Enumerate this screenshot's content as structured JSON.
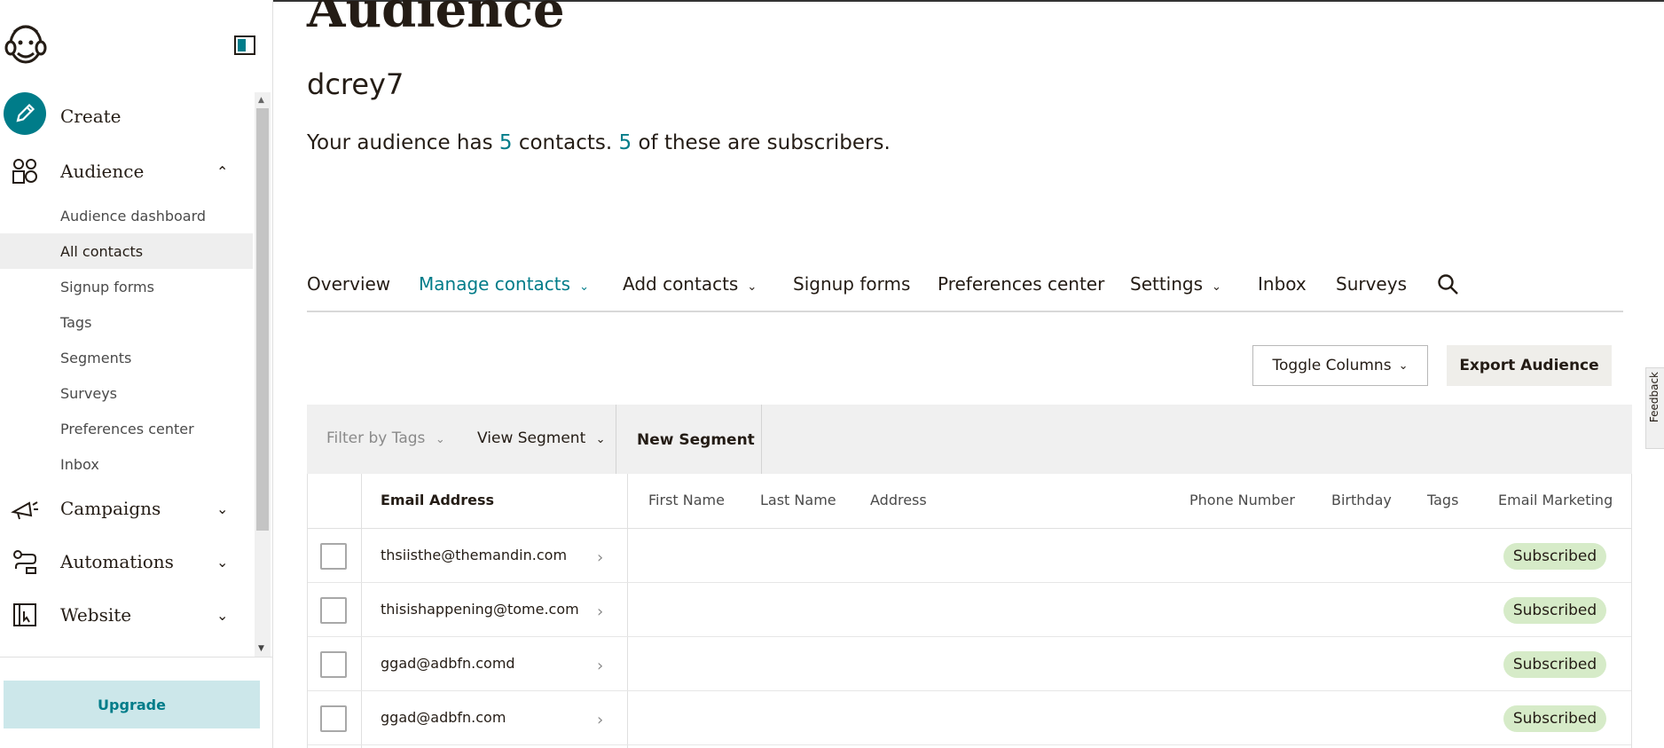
{
  "sidebar": {
    "nav": {
      "create": "Create",
      "audience": "Audience",
      "campaigns": "Campaigns",
      "automations": "Automations",
      "website": "Website"
    },
    "audience_sub": [
      "Audience dashboard",
      "All contacts",
      "Signup forms",
      "Tags",
      "Segments",
      "Surveys",
      "Preferences center",
      "Inbox"
    ],
    "active_sub": "All contacts",
    "upgrade": "Upgrade"
  },
  "page": {
    "title": "Audience",
    "audience_name": "dcrey7",
    "summary": {
      "prefix": "Your audience has ",
      "contacts": "5",
      "middle": " contacts. ",
      "subscribers": "5",
      "suffix": " of these are subscribers."
    }
  },
  "tabs": [
    {
      "label": "Overview"
    },
    {
      "label": "Manage contacts"
    },
    {
      "label": "Add contacts"
    },
    {
      "label": "Signup forms"
    },
    {
      "label": "Preferences center"
    },
    {
      "label": "Settings"
    },
    {
      "label": "Inbox"
    },
    {
      "label": "Surveys"
    }
  ],
  "actions": {
    "toggle_columns": "Toggle Columns",
    "export_audience": "Export Audience"
  },
  "filters": {
    "filter_by_tags": "Filter by Tags",
    "view_segment": "View Segment",
    "new_segment": "New Segment"
  },
  "table": {
    "columns": [
      "Email Address",
      "First Name",
      "Last Name",
      "Address",
      "Phone Number",
      "Birthday",
      "Tags",
      "Email Marketing"
    ],
    "rows": [
      {
        "email": "thsiisthe@themandin.com",
        "status": "Subscribed"
      },
      {
        "email": "thisishappening@tome.com",
        "status": "Subscribed"
      },
      {
        "email": "ggad@adbfn.comd",
        "status": "Subscribed"
      },
      {
        "email": "ggad@adbfn.com",
        "status": "Subscribed"
      }
    ]
  },
  "feedback": "Feedback",
  "colors": {
    "accent": "#007c89",
    "subscribed_badge": "#d6ebc8",
    "upgrade_bg": "#cce7ea"
  }
}
